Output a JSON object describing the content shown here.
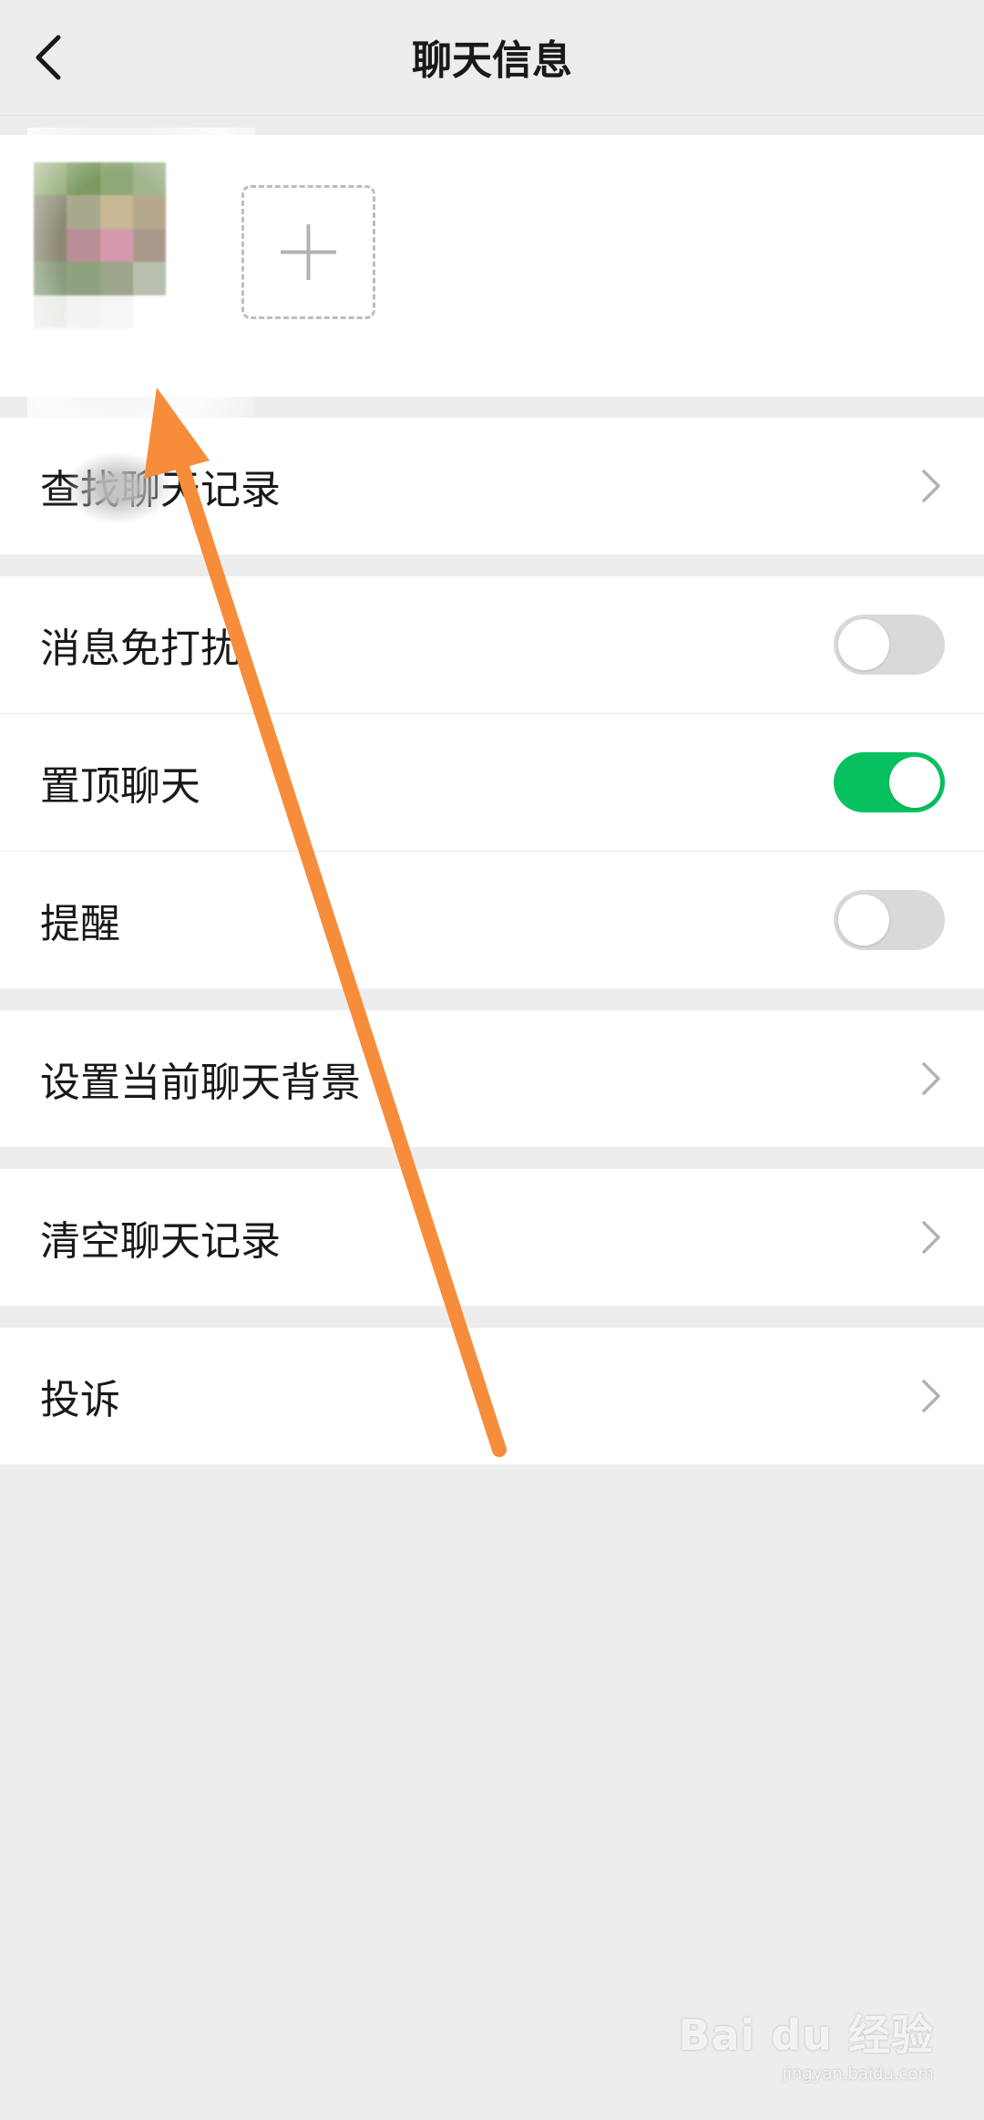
{
  "nav": {
    "title": "聊天信息",
    "back_icon": "chevron-left-icon"
  },
  "members": {
    "add_icon": "plus-icon",
    "avatar_colors": [
      "#8fa86f",
      "#7c9a62",
      "#8ea877",
      "#a2b48e",
      "#8a8a72",
      "#a8a88c",
      "#c9b895",
      "#b5a88e",
      "#8c8872",
      "#b88f96",
      "#d49aac",
      "#a9998c",
      "#889c7c",
      "#8fa27f",
      "#9aa58b",
      "#b8bfae",
      "#e8ece4",
      "#f2f2f0",
      "#f6f6f4",
      "#ffffff"
    ]
  },
  "sections": {
    "history": {
      "label": "查找聊天记录"
    },
    "mute": {
      "label": "消息免打扰",
      "on": false
    },
    "pin": {
      "label": "置顶聊天",
      "on": true
    },
    "remind": {
      "label": "提醒",
      "on": false
    },
    "background": {
      "label": "设置当前聊天背景"
    },
    "clear": {
      "label": "清空聊天记录"
    },
    "report": {
      "label": "投诉"
    }
  },
  "colors": {
    "toggle_on": "#07c160",
    "toggle_off": "#d9d9d9",
    "annotation_arrow": "#f78c3b"
  },
  "watermark": {
    "logo": "Bai du 经验",
    "url": "jingyan.baidu.com"
  }
}
